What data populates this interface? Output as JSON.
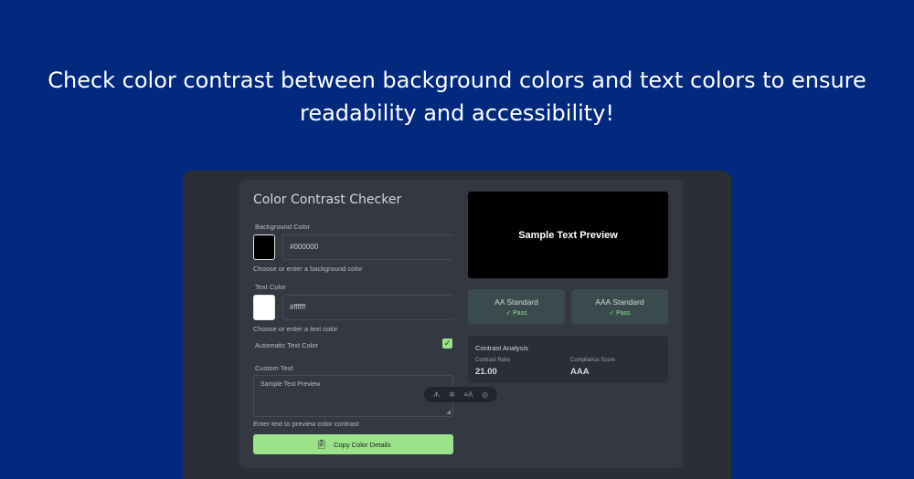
{
  "headline": {
    "line1": "Check color contrast between background colors and text colors to ensure",
    "line2": "readability and accessibility!"
  },
  "app": {
    "title": "Color Contrast Checker"
  },
  "background_color": {
    "label": "Background Color",
    "value": "#000000",
    "swatch": "#000000",
    "hint": "Choose or enter a background color"
  },
  "text_color": {
    "label": "Text Color",
    "value": "#ffffff",
    "swatch": "#ffffff",
    "hint": "Choose or enter a text color"
  },
  "automatic_text_color": {
    "label": "Automatic Text Color",
    "checked": true
  },
  "custom_text": {
    "label": "Custom Text",
    "value": "Sample Text Preview",
    "hint": "Enter text to preview color contrast"
  },
  "toolbar_icons": [
    "text-format-icon",
    "settings-icon",
    "translate-icon",
    "target-icon"
  ],
  "copy_button": {
    "label": "Copy Color Details",
    "icon": "clipboard-icon"
  },
  "preview": {
    "text": "Sample Text Preview",
    "background": "#000000",
    "foreground": "#ffffff"
  },
  "standards": [
    {
      "name": "AA Standard",
      "result": "✓ Pass"
    },
    {
      "name": "AAA Standard",
      "result": "✓ Pass"
    }
  ],
  "analysis": {
    "title": "Contrast Analysis",
    "ratio_label": "Contrast Ratio",
    "ratio_value": "21.00",
    "score_label": "Compliance Score",
    "score_value": "AAA"
  },
  "colors": {
    "page_background": "#03297f",
    "accent": "#9be28b",
    "pass": "#8fe08a"
  }
}
